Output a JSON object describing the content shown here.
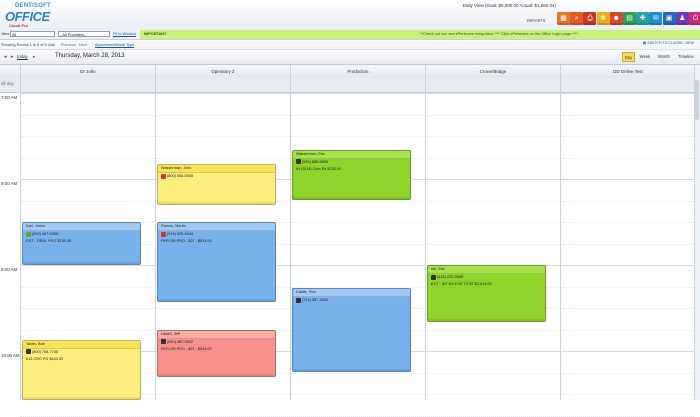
{
  "header": {
    "logo_top": "DENTISOFT",
    "logo_main": "OFFICE",
    "logo_sub": "Cloud Pro",
    "goal_text": "Daily View (Goal: $6,500.00 Actual: $1,685.04)",
    "reports_label": "REPORTS"
  },
  "toolbar": {
    "icons": [
      {
        "name": "calendar-icon",
        "color": "#e07a2a",
        "glyph": "▦"
      },
      {
        "name": "search-icon",
        "color": "#e05a2a",
        "glyph": "⌕"
      },
      {
        "name": "print-icon",
        "color": "#c0392b",
        "glyph": "⎙"
      },
      {
        "name": "settings-icon",
        "color": "#e8b020",
        "glyph": "✲"
      },
      {
        "name": "patient-icon",
        "color": "#d9482b",
        "glyph": "☻"
      },
      {
        "name": "schedule-icon",
        "color": "#2e9e5a",
        "glyph": "▤"
      },
      {
        "name": "ledger-icon",
        "color": "#2aa3a0",
        "glyph": "✚"
      },
      {
        "name": "chart-icon",
        "color": "#1f8fd0",
        "glyph": "✉"
      },
      {
        "name": "message-icon",
        "color": "#2a66c8",
        "glyph": "▣"
      },
      {
        "name": "user-icon",
        "color": "#6a3fb0",
        "glyph": "♟"
      },
      {
        "name": "logout-icon",
        "color": "#d02a7a",
        "glyph": "⏻"
      }
    ]
  },
  "filters": {
    "view_label": "View",
    "view_value": "All",
    "providers_value": "--All Providers--",
    "fit_window": "Fit to Window",
    "important": "IMPORTANT",
    "news": "**Check out our new ePeriocare integration **** Click ePeriocare on the Office Login page ****"
  },
  "showing": {
    "text": "Showing Rooms 1 to 5 of 5 total",
    "previous": "Previous",
    "next": "Next",
    "appt_book": "AppointmentBook Type"
  },
  "nav": {
    "prev": "◄",
    "next": "►",
    "today": "today",
    "date": "Thursday, March 28, 2013",
    "views": [
      "Day",
      "Week",
      "Month",
      "Timeline"
    ],
    "active_view": "Day",
    "switch_label": "SWITCH TO CLASSIC VIEW"
  },
  "columns": [
    "Dr John",
    "Operatory 2",
    "Production",
    "Crown/Bridge",
    "DD Online Test"
  ],
  "all_day": "all-day",
  "times": [
    "7:00 AM",
    "8:00 AM",
    "9:00 AM",
    "10:00 AM"
  ],
  "appointments": [
    {
      "col": 0,
      "color": "blue",
      "start": 8.5,
      "end": 9.0,
      "name": "Karl, Junior",
      "phone": "(800) 467-5959",
      "detail": "EXT - ORAL HYG $138.38",
      "icon": "#5aaa3a"
    },
    {
      "col": 0,
      "color": "yellow",
      "start": 9.87,
      "end": 10.75,
      "name": "Takes, Bob",
      "phone": "(800) 758-7745",
      "detail": "#12 CRO PG $433.33",
      "icon": "#333"
    },
    {
      "col": 1,
      "color": "yellow",
      "start": 7.83,
      "end": 8.3,
      "name": "Wasserman, John",
      "phone": "(800) 555-5555",
      "detail": "",
      "icon": "#c33"
    },
    {
      "col": 1,
      "color": "blue",
      "start": 8.5,
      "end": 9.43,
      "name": "Ramos, Martin",
      "phone": "(916) 835-4444",
      "detail": "PER OR PRO - $27 - $634.00",
      "icon": "#c33"
    },
    {
      "col": 1,
      "color": "red",
      "start": 9.75,
      "end": 10.3,
      "name": "Litwell, Jeff",
      "phone": "(540) 467-9922",
      "detail": "PER OR PRO - $27 - $634.00",
      "icon": "#333"
    },
    {
      "col": 2,
      "color": "green",
      "start": 7.66,
      "end": 8.25,
      "name": "Wasserman, Eric",
      "phone": "(555) 888-5555",
      "detail": "#4 (SLM) Com Rs $230.00",
      "icon": "#333"
    },
    {
      "col": 2,
      "color": "blue",
      "start": 9.27,
      "end": 10.25,
      "name": "Castle, Ron",
      "phone": "(714) 387-4603",
      "detail": "",
      "icon": "#333"
    },
    {
      "col": 3,
      "color": "green",
      "start": 9.0,
      "end": 9.66,
      "name": "Ide, Eric",
      "phone": "(415) 222-5959",
      "detail": "EXT - INT EX EVE TX $7 $2,614.00",
      "icon": "#333"
    }
  ]
}
